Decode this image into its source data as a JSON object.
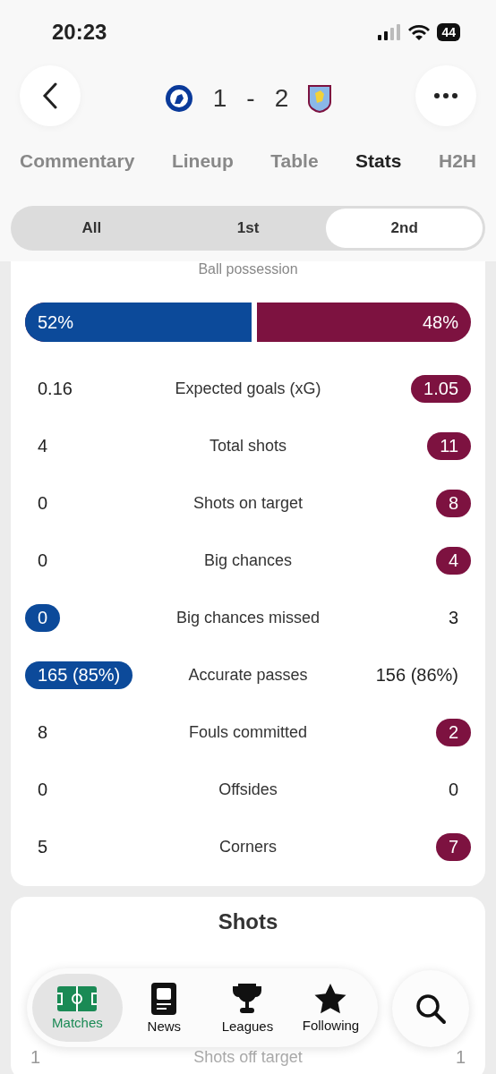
{
  "status_bar": {
    "time": "20:23",
    "battery": "44"
  },
  "match": {
    "home_score": "1",
    "separator": "-",
    "away_score": "2"
  },
  "tabs": [
    {
      "label": "Commentary",
      "selected": false
    },
    {
      "label": "Lineup",
      "selected": false
    },
    {
      "label": "Table",
      "selected": false
    },
    {
      "label": "Stats",
      "selected": true
    },
    {
      "label": "H2H",
      "selected": false
    }
  ],
  "periods": [
    {
      "label": "All",
      "selected": false
    },
    {
      "label": "1st",
      "selected": false
    },
    {
      "label": "2nd",
      "selected": true
    }
  ],
  "possession": {
    "label": "Ball possession",
    "home": "52%",
    "away": "48%",
    "level": 0.52
  },
  "stats": [
    {
      "label": "Expected goals (xG)",
      "home": "0.16",
      "away": "1.05",
      "home_highlighted": false,
      "away_highlighted": true
    },
    {
      "label": "Total shots",
      "home": "4",
      "away": "11",
      "home_highlighted": false,
      "away_highlighted": true
    },
    {
      "label": "Shots on target",
      "home": "0",
      "away": "8",
      "home_highlighted": false,
      "away_highlighted": true
    },
    {
      "label": "Big chances",
      "home": "0",
      "away": "4",
      "home_highlighted": false,
      "away_highlighted": true
    },
    {
      "label": "Big chances missed",
      "home": "0",
      "away": "3",
      "home_highlighted": true,
      "away_highlighted": false
    },
    {
      "label": "Accurate passes",
      "home": "165 (85%)",
      "away": "156 (86%)",
      "home_highlighted": true,
      "away_highlighted": false
    },
    {
      "label": "Fouls committed",
      "home": "8",
      "away": "2",
      "home_highlighted": false,
      "away_highlighted": true
    },
    {
      "label": "Offsides",
      "home": "0",
      "away": "0",
      "home_highlighted": false,
      "away_highlighted": false
    },
    {
      "label": "Corners",
      "home": "5",
      "away": "7",
      "home_highlighted": false,
      "away_highlighted": true
    }
  ],
  "shots": {
    "title": "Shots",
    "rows": [
      {
        "label": "Shots off target",
        "home": "1",
        "away": "1"
      }
    ]
  },
  "nav": [
    {
      "label": "Matches",
      "selected": true,
      "kind": "pitch"
    },
    {
      "label": "News",
      "selected": false,
      "kind": "news"
    },
    {
      "label": "Leagues",
      "selected": false,
      "kind": "trophy"
    },
    {
      "label": "Following",
      "selected": false,
      "kind": "star"
    }
  ]
}
